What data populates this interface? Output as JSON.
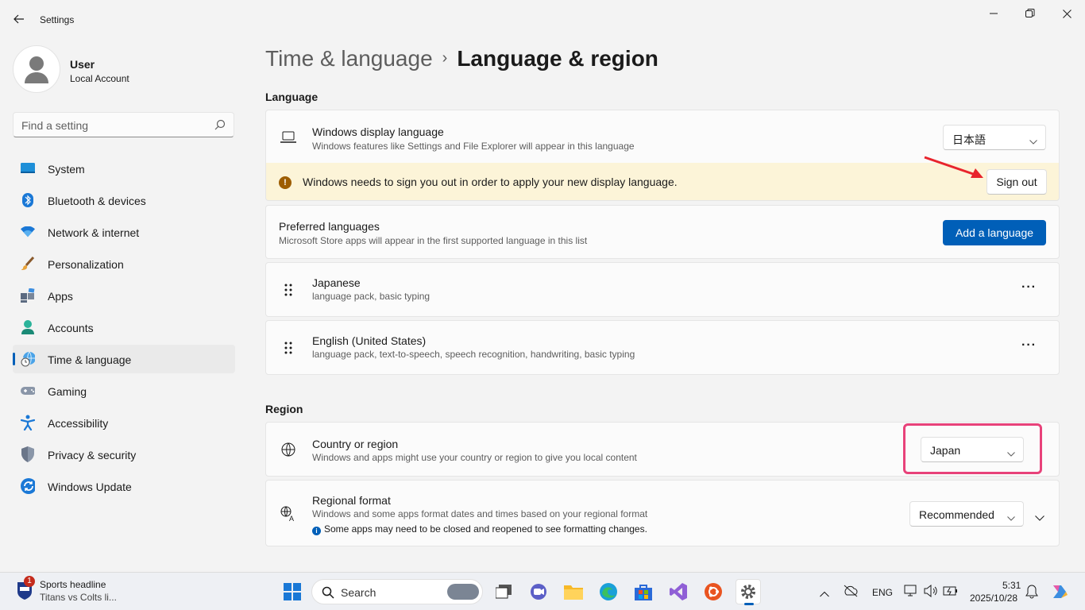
{
  "window": {
    "title": "Settings"
  },
  "colors": {
    "accent": "#005fb8",
    "warning_bg": "#fcf4d8",
    "highlight": "#e8427a",
    "annotation_arrow": "#e8242c"
  },
  "profile": {
    "name": "User",
    "account_type": "Local Account"
  },
  "search": {
    "placeholder": "Find a setting"
  },
  "sidebar": {
    "items": [
      {
        "label": "System",
        "icon": "system-icon"
      },
      {
        "label": "Bluetooth & devices",
        "icon": "bluetooth-icon"
      },
      {
        "label": "Network & internet",
        "icon": "wifi-icon"
      },
      {
        "label": "Personalization",
        "icon": "brush-icon"
      },
      {
        "label": "Apps",
        "icon": "apps-icon"
      },
      {
        "label": "Accounts",
        "icon": "person-icon"
      },
      {
        "label": "Time & language",
        "icon": "globe-clock-icon",
        "active": true
      },
      {
        "label": "Gaming",
        "icon": "gamepad-icon"
      },
      {
        "label": "Accessibility",
        "icon": "accessibility-icon"
      },
      {
        "label": "Privacy & security",
        "icon": "shield-icon"
      },
      {
        "label": "Windows Update",
        "icon": "update-icon"
      }
    ]
  },
  "breadcrumb": {
    "parent": "Time & language",
    "separator": "›",
    "current": "Language & region"
  },
  "language": {
    "section_title": "Language",
    "display_language": {
      "title": "Windows display language",
      "description": "Windows features like Settings and File Explorer will appear in this language",
      "value": "日本語"
    },
    "warning": {
      "text": "Windows needs to sign you out in order to apply your new display language.",
      "button": "Sign out"
    },
    "preferred": {
      "title": "Preferred languages",
      "description": "Microsoft Store apps will appear in the first supported language in this list",
      "button": "Add a language"
    },
    "languages": [
      {
        "name": "Japanese",
        "features": "language pack, basic typing"
      },
      {
        "name": "English (United States)",
        "features": "language pack, text-to-speech, speech recognition, handwriting, basic typing"
      }
    ],
    "more_label": "···"
  },
  "region": {
    "section_title": "Region",
    "country": {
      "title": "Country or region",
      "description": "Windows and apps might use your country or region to give you local content",
      "value": "Japan"
    },
    "format": {
      "title": "Regional format",
      "description": "Windows and some apps format dates and times based on your regional format",
      "note": "Some apps may need to be closed and reopened to see formatting changes.",
      "value": "Recommended"
    }
  },
  "taskbar": {
    "news": {
      "badge": "1",
      "title": "Sports headline",
      "subtitle": "Titans vs Colts li..."
    },
    "search_label": "Search",
    "language_indicator": "ENG",
    "time": "5:31",
    "date": "2025/10/28"
  }
}
